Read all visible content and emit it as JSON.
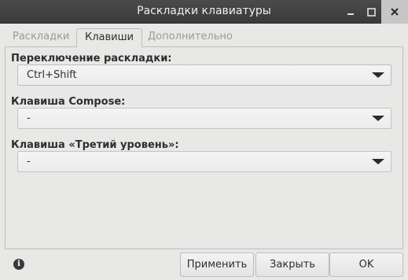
{
  "window": {
    "title": "Раскладки клавиатуры"
  },
  "tabs": [
    {
      "label": "Раскладки",
      "active": false
    },
    {
      "label": "Клавиши",
      "active": true
    },
    {
      "label": "Дополнительно",
      "active": false
    }
  ],
  "keys": {
    "switch_label": "Переключение раскладки:",
    "switch_value": "Ctrl+Shift",
    "compose_label": "Клавиша Compose:",
    "compose_value": "-",
    "third_level_label": "Клавиша «Третий уровень»:",
    "third_level_value": "-"
  },
  "buttons": {
    "apply": "Применить",
    "close": "Закрыть",
    "ok": "OK"
  },
  "icons": {
    "info": "i"
  }
}
